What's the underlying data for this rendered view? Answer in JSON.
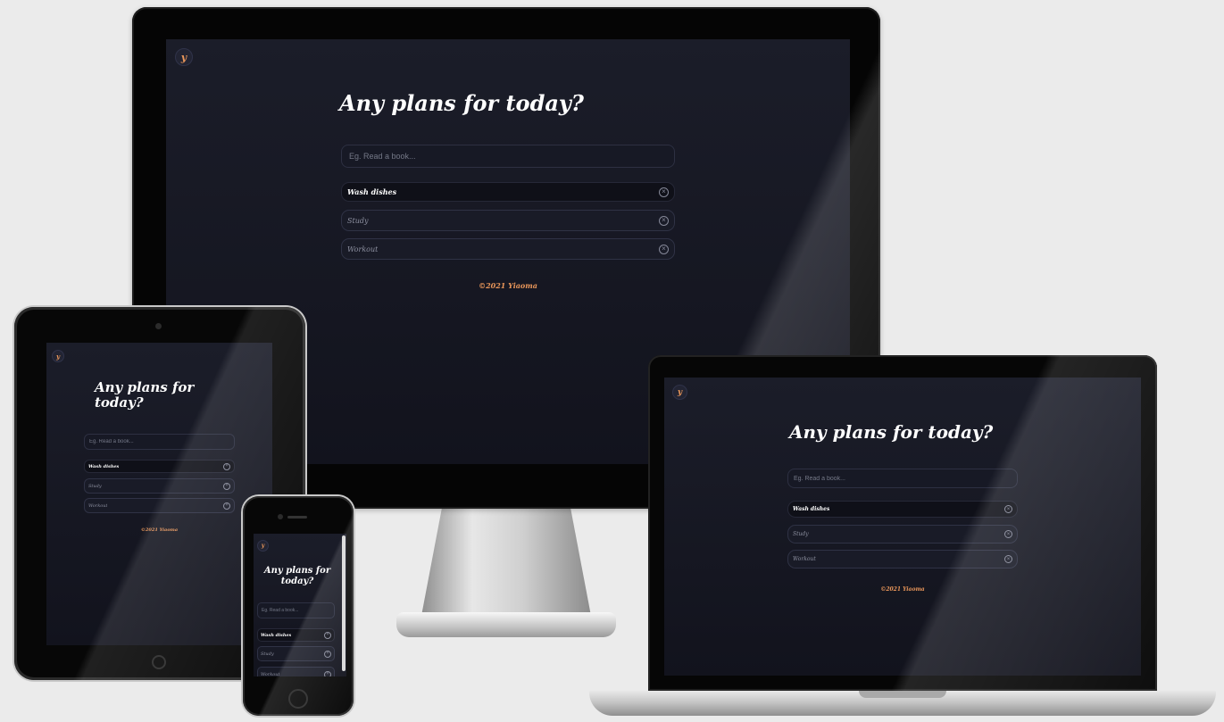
{
  "app": {
    "logo": "y",
    "title": "Any plans for today?",
    "input_placeholder": "Eg. Read a book...",
    "todos": [
      {
        "text": "Wash dishes",
        "done": true
      },
      {
        "text": "Study",
        "done": false
      },
      {
        "text": "Workout",
        "done": false
      }
    ],
    "remove_glyph": "×",
    "footer": "©2021 Yiaoma"
  },
  "colors": {
    "background": "#1b1d29",
    "accent": "#e9965a",
    "text": "#ffffff"
  }
}
